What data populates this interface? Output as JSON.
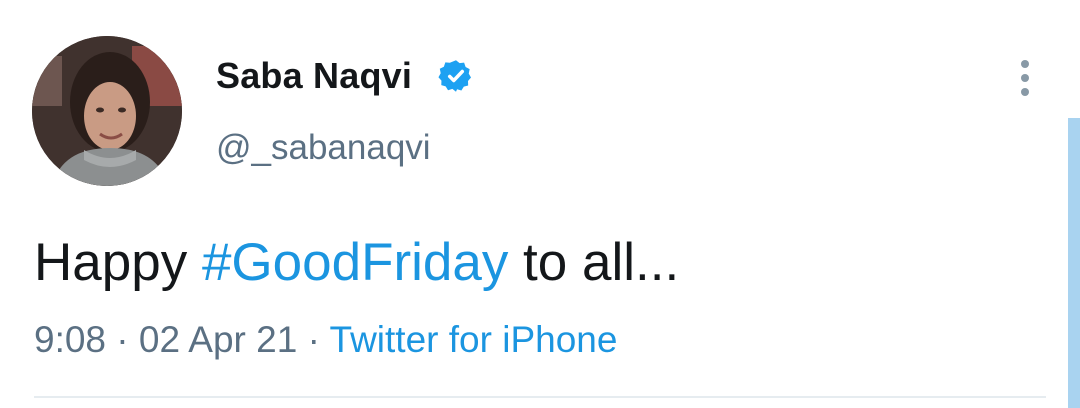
{
  "tweet": {
    "author": {
      "display_name": "Saba Naqvi",
      "handle": "@_sabanaqvi",
      "verified": true
    },
    "text": {
      "before": "Happy ",
      "hashtag": "#GoodFriday",
      "after": " to all..."
    },
    "meta": {
      "time": "9:08",
      "separator": " · ",
      "date": "02 Apr 21",
      "source": "Twitter for iPhone"
    }
  },
  "icons": {
    "verified": "verified-badge-icon",
    "more": "more-options-icon"
  },
  "colors": {
    "text": "#14171a",
    "secondary": "#5b7083",
    "link": "#1b95e0",
    "verified": "#1da1f2",
    "divider": "#e6ecf0",
    "scrollbar": "#a9d3f0"
  }
}
